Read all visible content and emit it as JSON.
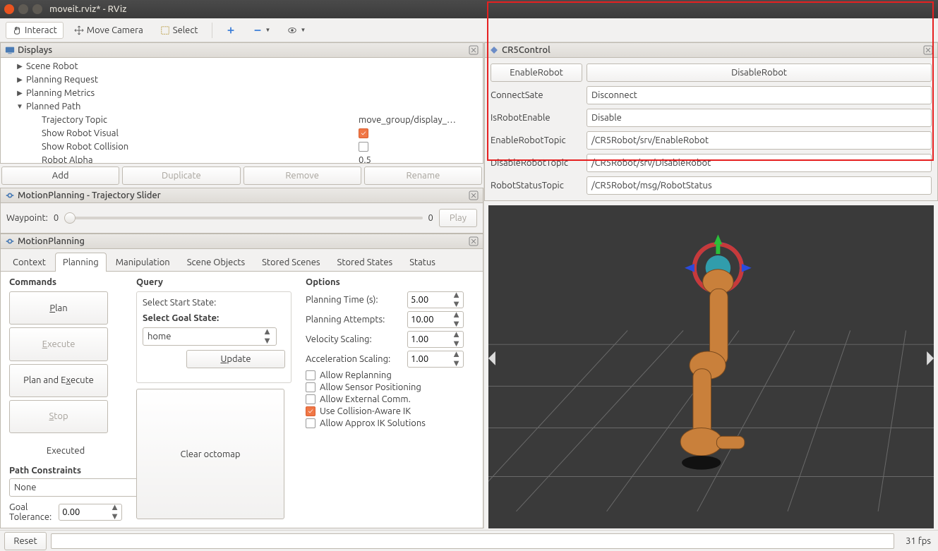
{
  "window": {
    "title": "moveit.rviz* - RViz"
  },
  "toolbar": {
    "interact": "Interact",
    "move_camera": "Move Camera",
    "select": "Select"
  },
  "displays": {
    "title": "Displays",
    "items": [
      "Scene Robot",
      "Planning Request",
      "Planning Metrics",
      "Planned Path"
    ],
    "planned_path": {
      "trajectory_topic": {
        "label": "Trajectory Topic",
        "value": "move_group/display_…"
      },
      "show_visual": {
        "label": "Show Robot Visual",
        "checked": true
      },
      "show_collision": {
        "label": "Show Robot Collision",
        "checked": false
      },
      "robot_alpha": {
        "label": "Robot Alpha",
        "value": "0.5"
      }
    },
    "buttons": {
      "add": "Add",
      "duplicate": "Duplicate",
      "remove": "Remove",
      "rename": "Rename"
    }
  },
  "traj": {
    "title": "MotionPlanning - Trajectory Slider",
    "waypoint_label": "Waypoint:",
    "waypoint_start": "0",
    "waypoint_end": "0",
    "play": "Play"
  },
  "mp": {
    "title": "MotionPlanning",
    "tabs": [
      "Context",
      "Planning",
      "Manipulation",
      "Scene Objects",
      "Stored Scenes",
      "Stored States",
      "Status"
    ],
    "active_tab": 1,
    "commands": {
      "heading": "Commands",
      "plan": "Plan",
      "execute": "Execute",
      "plan_execute": "Plan and Execute",
      "stop": "Stop",
      "executed": "Executed"
    },
    "query": {
      "heading": "Query",
      "start_state_label": "Select Start State:",
      "goal_state_label": "Select Goal State:",
      "goal_value": "home",
      "update": "Update",
      "clear_octomap": "Clear octomap"
    },
    "options": {
      "heading": "Options",
      "planning_time": {
        "label": "Planning Time (s):",
        "value": "5.00"
      },
      "planning_attempts": {
        "label": "Planning Attempts:",
        "value": "10.00"
      },
      "velocity_scaling": {
        "label": "Velocity Scaling:",
        "value": "1.00"
      },
      "accel_scaling": {
        "label": "Acceleration Scaling:",
        "value": "1.00"
      },
      "allow_replanning": {
        "label": "Allow Replanning",
        "checked": false
      },
      "allow_sensor": {
        "label": "Allow Sensor Positioning",
        "checked": false
      },
      "allow_external": {
        "label": "Allow External Comm.",
        "checked": false
      },
      "collision_ik": {
        "label": "Use Collision-Aware IK",
        "checked": true
      },
      "approx_ik": {
        "label": "Allow Approx IK Solutions",
        "checked": false
      }
    },
    "path_constraints": {
      "heading": "Path Constraints",
      "value": "None",
      "goal_tol_label": "Goal Tolerance:",
      "goal_tol_value": "0.00"
    }
  },
  "cr5": {
    "title": "CR5Control",
    "enable_btn": "EnableRobot",
    "disable_btn": "DisableRobot",
    "rows": [
      {
        "label": "ConnectSate",
        "value": "Disconnect"
      },
      {
        "label": "IsRobotEnable",
        "value": "Disable"
      },
      {
        "label": "EnableRobotTopic",
        "value": "/CR5Robot/srv/EnableRobot"
      },
      {
        "label": "DisableRobotTopic",
        "value": "/CR5Robot/srv/DisableRobot"
      },
      {
        "label": "RobotStatusTopic",
        "value": "/CR5Robot/msg/RobotStatus"
      }
    ]
  },
  "bottom": {
    "reset": "Reset",
    "fps": "31 fps"
  },
  "colors": {
    "accent": "#e95420",
    "highlight_border": "#e62020"
  }
}
